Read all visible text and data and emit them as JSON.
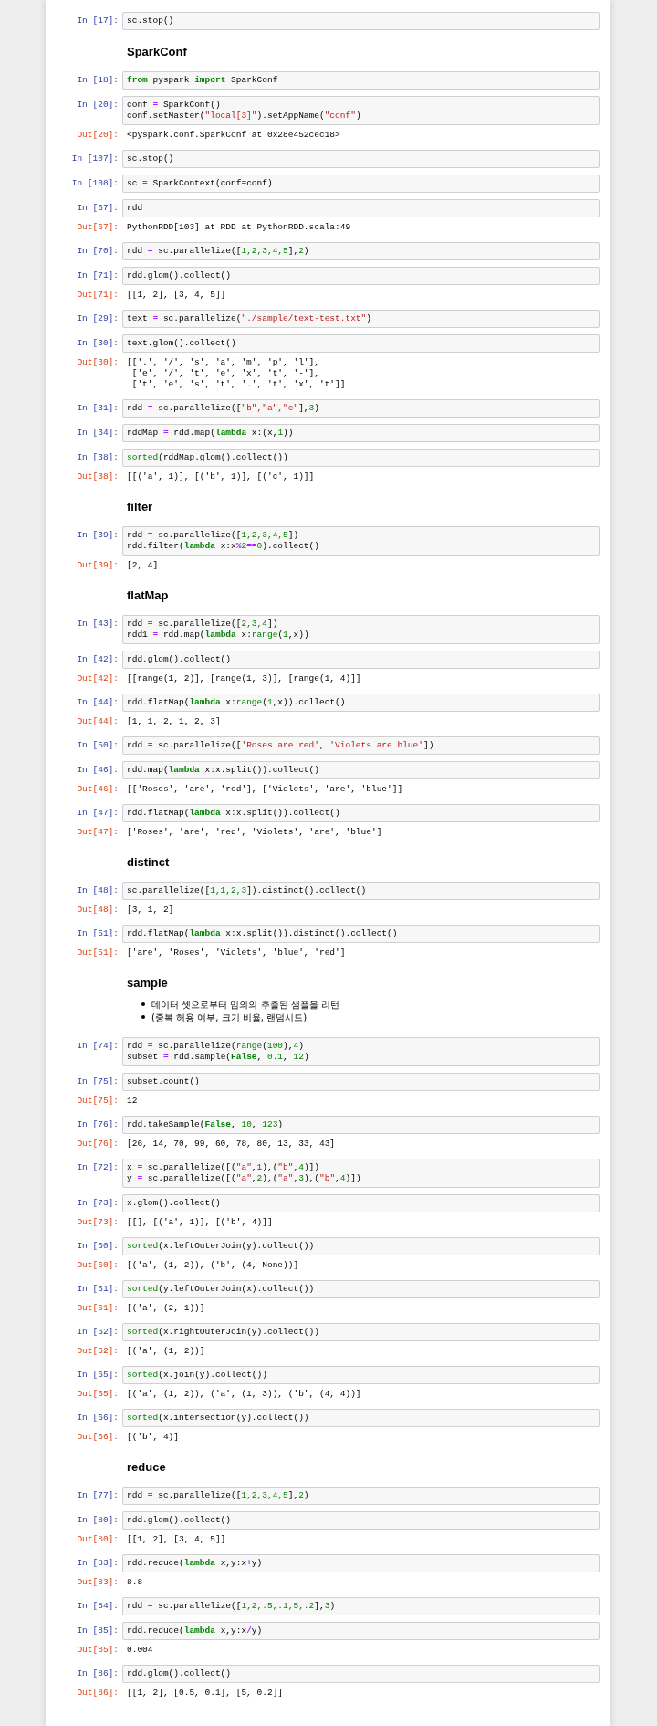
{
  "cells": [
    {
      "kind": "code",
      "prompt": "In [17]:",
      "source": [
        [
          {
            "text": "sc.stop()",
            "kind": "plain"
          }
        ]
      ]
    },
    {
      "kind": "heading",
      "text": "SparkConf"
    },
    {
      "kind": "code",
      "prompt": "In [18]:",
      "source": [
        [
          {
            "text": "from",
            "kind": "keyword"
          },
          {
            "text": " pyspark ",
            "kind": "plain"
          },
          {
            "text": "import",
            "kind": "keyword"
          },
          {
            "text": " SparkConf",
            "kind": "plain"
          }
        ]
      ]
    },
    {
      "kind": "code",
      "prompt": "In [20]:",
      "source": [
        [
          {
            "text": "conf ",
            "kind": "plain"
          },
          {
            "text": "=",
            "kind": "operator"
          },
          {
            "text": " SparkConf()",
            "kind": "plain"
          }
        ],
        [
          {
            "text": "conf.setMaster(",
            "kind": "plain"
          },
          {
            "text": "\"local[3]\"",
            "kind": "string"
          },
          {
            "text": ").setAppName(",
            "kind": "plain"
          },
          {
            "text": "\"conf\"",
            "kind": "string"
          },
          {
            "text": ")",
            "kind": "plain"
          }
        ]
      ],
      "output": {
        "prompt": "Out[20]:",
        "lines": [
          "<pyspark.conf.SparkConf at 0x28e452cec18>"
        ]
      }
    },
    {
      "kind": "code",
      "prompt": "In [107]:",
      "source": [
        [
          {
            "text": "sc.stop()",
            "kind": "plain"
          }
        ]
      ]
    },
    {
      "kind": "code",
      "prompt": "In [108]:",
      "source": [
        [
          {
            "text": "sc ",
            "kind": "plain"
          },
          {
            "text": "=",
            "kind": "operator"
          },
          {
            "text": " SparkContext(conf",
            "kind": "plain"
          },
          {
            "text": "=",
            "kind": "operator"
          },
          {
            "text": "conf)",
            "kind": "plain"
          }
        ]
      ]
    },
    {
      "kind": "code",
      "prompt": "In [67]:",
      "source": [
        [
          {
            "text": "rdd",
            "kind": "plain"
          }
        ]
      ],
      "output": {
        "prompt": "Out[67]:",
        "lines": [
          "PythonRDD[103] at RDD at PythonRDD.scala:49"
        ]
      }
    },
    {
      "kind": "code",
      "prompt": "In [70]:",
      "source": [
        [
          {
            "text": "rdd ",
            "kind": "plain"
          },
          {
            "text": "=",
            "kind": "operator"
          },
          {
            "text": " sc.parallelize([",
            "kind": "plain"
          },
          {
            "text": "1,2,3,4,5",
            "kind": "number"
          },
          {
            "text": "],",
            "kind": "plain"
          },
          {
            "text": "2",
            "kind": "number"
          },
          {
            "text": ")",
            "kind": "plain"
          }
        ]
      ]
    },
    {
      "kind": "code",
      "prompt": "In [71]:",
      "source": [
        [
          {
            "text": "rdd.glom().collect()",
            "kind": "plain"
          }
        ]
      ],
      "output": {
        "prompt": "Out[71]:",
        "lines": [
          "[[1, 2], [3, 4, 5]]"
        ]
      }
    },
    {
      "kind": "code",
      "prompt": "In [29]:",
      "source": [
        [
          {
            "text": "text ",
            "kind": "plain"
          },
          {
            "text": "=",
            "kind": "operator"
          },
          {
            "text": " sc.parallelize(",
            "kind": "plain"
          },
          {
            "text": "\"./sample/text-test.txt\"",
            "kind": "string"
          },
          {
            "text": ")",
            "kind": "plain"
          }
        ]
      ]
    },
    {
      "kind": "code",
      "prompt": "In [30]:",
      "source": [
        [
          {
            "text": "text.glom().collect()",
            "kind": "plain"
          }
        ]
      ],
      "output": {
        "prompt": "Out[30]:",
        "lines": [
          "[['.', '/', 's', 'a', 'm', 'p', 'l'],",
          " ['e', '/', 't', 'e', 'x', 't', '-'],",
          " ['t', 'e', 's', 't', '.', 't', 'x', 't']]"
        ]
      }
    },
    {
      "kind": "code",
      "prompt": "In [31]:",
      "source": [
        [
          {
            "text": "rdd ",
            "kind": "plain"
          },
          {
            "text": "=",
            "kind": "operator"
          },
          {
            "text": " sc.parallelize([",
            "kind": "plain"
          },
          {
            "text": "\"b\",\"a\",\"c\"",
            "kind": "string"
          },
          {
            "text": "],",
            "kind": "plain"
          },
          {
            "text": "3",
            "kind": "number"
          },
          {
            "text": ")",
            "kind": "plain"
          }
        ]
      ]
    },
    {
      "kind": "code",
      "prompt": "In [34]:",
      "source": [
        [
          {
            "text": "rddMap ",
            "kind": "plain"
          },
          {
            "text": "=",
            "kind": "operator"
          },
          {
            "text": " rdd.map(",
            "kind": "plain"
          },
          {
            "text": "lambda",
            "kind": "keyword"
          },
          {
            "text": " x:(x,",
            "kind": "plain"
          },
          {
            "text": "1",
            "kind": "number"
          },
          {
            "text": "))",
            "kind": "plain"
          }
        ]
      ]
    },
    {
      "kind": "code",
      "prompt": "In [38]:",
      "source": [
        [
          {
            "text": "sorted",
            "kind": "builtin"
          },
          {
            "text": "(rddMap.glom().collect())",
            "kind": "plain"
          }
        ]
      ],
      "output": {
        "prompt": "Out[38]:",
        "lines": [
          "[[('a', 1)], [('b', 1)], [('c', 1)]]"
        ]
      }
    },
    {
      "kind": "heading",
      "text": "filter"
    },
    {
      "kind": "code",
      "prompt": "In [39]:",
      "source": [
        [
          {
            "text": "rdd ",
            "kind": "plain"
          },
          {
            "text": "=",
            "kind": "operator"
          },
          {
            "text": " sc.parallelize([",
            "kind": "plain"
          },
          {
            "text": "1,2,3,4,5",
            "kind": "number"
          },
          {
            "text": "])",
            "kind": "plain"
          }
        ],
        [
          {
            "text": "rdd.filter(",
            "kind": "plain"
          },
          {
            "text": "lambda",
            "kind": "keyword"
          },
          {
            "text": " x:x",
            "kind": "plain"
          },
          {
            "text": "%",
            "kind": "operator"
          },
          {
            "text": "2",
            "kind": "number"
          },
          {
            "text": "==",
            "kind": "operator"
          },
          {
            "text": "0",
            "kind": "number"
          },
          {
            "text": ").collect()",
            "kind": "plain"
          }
        ]
      ],
      "output": {
        "prompt": "Out[39]:",
        "lines": [
          "[2, 4]"
        ]
      }
    },
    {
      "kind": "heading",
      "text": "flatMap"
    },
    {
      "kind": "code",
      "prompt": "In [43]:",
      "source": [
        [
          {
            "text": "rdd ",
            "kind": "plain"
          },
          {
            "text": "=",
            "kind": "operator"
          },
          {
            "text": " sc.parallelize([",
            "kind": "plain"
          },
          {
            "text": "2,3,4",
            "kind": "number"
          },
          {
            "text": "])",
            "kind": "plain"
          }
        ],
        [
          {
            "text": "rdd1 ",
            "kind": "plain"
          },
          {
            "text": "=",
            "kind": "operator"
          },
          {
            "text": " rdd.map(",
            "kind": "plain"
          },
          {
            "text": "lambda",
            "kind": "keyword"
          },
          {
            "text": " x:",
            "kind": "plain"
          },
          {
            "text": "range",
            "kind": "builtin"
          },
          {
            "text": "(",
            "kind": "plain"
          },
          {
            "text": "1",
            "kind": "number"
          },
          {
            "text": ",x))",
            "kind": "plain"
          }
        ]
      ]
    },
    {
      "kind": "code",
      "prompt": "In [42]:",
      "source": [
        [
          {
            "text": "rdd.glom().collect()",
            "kind": "plain"
          }
        ]
      ],
      "output": {
        "prompt": "Out[42]:",
        "lines": [
          "[[range(1, 2)], [range(1, 3)], [range(1, 4)]]"
        ]
      }
    },
    {
      "kind": "code",
      "prompt": "In [44]:",
      "source": [
        [
          {
            "text": "rdd.flatMap(",
            "kind": "plain"
          },
          {
            "text": "lambda",
            "kind": "keyword"
          },
          {
            "text": " x:",
            "kind": "plain"
          },
          {
            "text": "range",
            "kind": "builtin"
          },
          {
            "text": "(",
            "kind": "plain"
          },
          {
            "text": "1",
            "kind": "number"
          },
          {
            "text": ",x)).collect()",
            "kind": "plain"
          }
        ]
      ],
      "output": {
        "prompt": "Out[44]:",
        "lines": [
          "[1, 1, 2, 1, 2, 3]"
        ]
      }
    },
    {
      "kind": "code",
      "prompt": "In [50]:",
      "source": [
        [
          {
            "text": "rdd ",
            "kind": "plain"
          },
          {
            "text": "=",
            "kind": "operator"
          },
          {
            "text": " sc.parallelize([",
            "kind": "plain"
          },
          {
            "text": "'Roses are red'",
            "kind": "string"
          },
          {
            "text": ", ",
            "kind": "plain"
          },
          {
            "text": "'Violets are blue'",
            "kind": "string"
          },
          {
            "text": "])",
            "kind": "plain"
          }
        ]
      ]
    },
    {
      "kind": "code",
      "prompt": "In [46]:",
      "source": [
        [
          {
            "text": "rdd.map(",
            "kind": "plain"
          },
          {
            "text": "lambda",
            "kind": "keyword"
          },
          {
            "text": " x:x.split()).collect()",
            "kind": "plain"
          }
        ]
      ],
      "output": {
        "prompt": "Out[46]:",
        "lines": [
          "[['Roses', 'are', 'red'], ['Violets', 'are', 'blue']]"
        ]
      }
    },
    {
      "kind": "code",
      "prompt": "In [47]:",
      "source": [
        [
          {
            "text": "rdd.flatMap(",
            "kind": "plain"
          },
          {
            "text": "lambda",
            "kind": "keyword"
          },
          {
            "text": " x:x.split()).collect()",
            "kind": "plain"
          }
        ]
      ],
      "output": {
        "prompt": "Out[47]:",
        "lines": [
          "['Roses', 'are', 'red', 'Violets', 'are', 'blue']"
        ]
      }
    },
    {
      "kind": "heading",
      "text": "distinct"
    },
    {
      "kind": "code",
      "prompt": "In [48]:",
      "source": [
        [
          {
            "text": "sc.parallelize([",
            "kind": "plain"
          },
          {
            "text": "1,1,2,3",
            "kind": "number"
          },
          {
            "text": "]).distinct().collect()",
            "kind": "plain"
          }
        ]
      ],
      "output": {
        "prompt": "Out[48]:",
        "lines": [
          "[3, 1, 2]"
        ]
      }
    },
    {
      "kind": "code",
      "prompt": "In [51]:",
      "source": [
        [
          {
            "text": "rdd.flatMap(",
            "kind": "plain"
          },
          {
            "text": "lambda",
            "kind": "keyword"
          },
          {
            "text": " x:x.split()).distinct().collect()",
            "kind": "plain"
          }
        ]
      ],
      "output": {
        "prompt": "Out[51]:",
        "lines": [
          "['are', 'Roses', 'Violets', 'blue', 'red']"
        ]
      }
    },
    {
      "kind": "heading",
      "text": "sample",
      "bullets": [
        "데이터 셋으로부터 임의의 추출된 샘플을 리턴",
        "(중복 허용 여부, 크기 비율, 랜덤시드)"
      ]
    },
    {
      "kind": "code",
      "prompt": "In [74]:",
      "source": [
        [
          {
            "text": "rdd ",
            "kind": "plain"
          },
          {
            "text": "=",
            "kind": "operator"
          },
          {
            "text": " sc.parallelize(",
            "kind": "plain"
          },
          {
            "text": "range",
            "kind": "builtin"
          },
          {
            "text": "(",
            "kind": "plain"
          },
          {
            "text": "100",
            "kind": "number"
          },
          {
            "text": "),",
            "kind": "plain"
          },
          {
            "text": "4",
            "kind": "number"
          },
          {
            "text": ")",
            "kind": "plain"
          }
        ],
        [
          {
            "text": "subset ",
            "kind": "plain"
          },
          {
            "text": "=",
            "kind": "operator"
          },
          {
            "text": " rdd.sample(",
            "kind": "plain"
          },
          {
            "text": "False",
            "kind": "keyword"
          },
          {
            "text": ", ",
            "kind": "plain"
          },
          {
            "text": "0.1",
            "kind": "number"
          },
          {
            "text": ", ",
            "kind": "plain"
          },
          {
            "text": "12",
            "kind": "number"
          },
          {
            "text": ")",
            "kind": "plain"
          }
        ]
      ]
    },
    {
      "kind": "code",
      "prompt": "In [75]:",
      "source": [
        [
          {
            "text": "subset.count()",
            "kind": "plain"
          }
        ]
      ],
      "output": {
        "prompt": "Out[75]:",
        "lines": [
          "12"
        ]
      }
    },
    {
      "kind": "code",
      "prompt": "In [76]:",
      "source": [
        [
          {
            "text": "rdd.takeSample(",
            "kind": "plain"
          },
          {
            "text": "False",
            "kind": "keyword"
          },
          {
            "text": ", ",
            "kind": "plain"
          },
          {
            "text": "10",
            "kind": "number"
          },
          {
            "text": ", ",
            "kind": "plain"
          },
          {
            "text": "123",
            "kind": "number"
          },
          {
            "text": ")",
            "kind": "plain"
          }
        ]
      ],
      "output": {
        "prompt": "Out[76]:",
        "lines": [
          "[26, 14, 70, 99, 60, 78, 80, 13, 33, 43]"
        ]
      }
    },
    {
      "kind": "code",
      "prompt": "In [72]:",
      "source": [
        [
          {
            "text": "x ",
            "kind": "plain"
          },
          {
            "text": "=",
            "kind": "operator"
          },
          {
            "text": " sc.parallelize([(",
            "kind": "plain"
          },
          {
            "text": "\"a\"",
            "kind": "string"
          },
          {
            "text": ",",
            "kind": "plain"
          },
          {
            "text": "1",
            "kind": "number"
          },
          {
            "text": "),(",
            "kind": "plain"
          },
          {
            "text": "\"b\"",
            "kind": "string"
          },
          {
            "text": ",",
            "kind": "plain"
          },
          {
            "text": "4",
            "kind": "number"
          },
          {
            "text": ")])",
            "kind": "plain"
          }
        ],
        [
          {
            "text": "y ",
            "kind": "plain"
          },
          {
            "text": "=",
            "kind": "operator"
          },
          {
            "text": " sc.parallelize([(",
            "kind": "plain"
          },
          {
            "text": "\"a\"",
            "kind": "string"
          },
          {
            "text": ",",
            "kind": "plain"
          },
          {
            "text": "2",
            "kind": "number"
          },
          {
            "text": "),(",
            "kind": "plain"
          },
          {
            "text": "\"a\"",
            "kind": "string"
          },
          {
            "text": ",",
            "kind": "plain"
          },
          {
            "text": "3",
            "kind": "number"
          },
          {
            "text": "),(",
            "kind": "plain"
          },
          {
            "text": "\"b\"",
            "kind": "string"
          },
          {
            "text": ",",
            "kind": "plain"
          },
          {
            "text": "4",
            "kind": "number"
          },
          {
            "text": ")])",
            "kind": "plain"
          }
        ]
      ]
    },
    {
      "kind": "code",
      "prompt": "In [73]:",
      "source": [
        [
          {
            "text": "x.glom().collect()",
            "kind": "plain"
          }
        ]
      ],
      "output": {
        "prompt": "Out[73]:",
        "lines": [
          "[[], [('a', 1)], [('b', 4)]]"
        ]
      }
    },
    {
      "kind": "code",
      "prompt": "In [60]:",
      "source": [
        [
          {
            "text": "sorted",
            "kind": "builtin"
          },
          {
            "text": "(x.leftOuterJoin(y).collect())",
            "kind": "plain"
          }
        ]
      ],
      "output": {
        "prompt": "Out[60]:",
        "lines": [
          "[('a', (1, 2)), ('b', (4, None))]"
        ]
      }
    },
    {
      "kind": "code",
      "prompt": "In [61]:",
      "source": [
        [
          {
            "text": "sorted",
            "kind": "builtin"
          },
          {
            "text": "(y.leftOuterJoin(x).collect())",
            "kind": "plain"
          }
        ]
      ],
      "output": {
        "prompt": "Out[61]:",
        "lines": [
          "[('a', (2, 1))]"
        ]
      }
    },
    {
      "kind": "code",
      "prompt": "In [62]:",
      "source": [
        [
          {
            "text": "sorted",
            "kind": "builtin"
          },
          {
            "text": "(x.rightOuterJoin(y).collect())",
            "kind": "plain"
          }
        ]
      ],
      "output": {
        "prompt": "Out[62]:",
        "lines": [
          "[('a', (1, 2))]"
        ]
      }
    },
    {
      "kind": "code",
      "prompt": "In [65]:",
      "source": [
        [
          {
            "text": "sorted",
            "kind": "builtin"
          },
          {
            "text": "(x.join(y).collect())",
            "kind": "plain"
          }
        ]
      ],
      "output": {
        "prompt": "Out[65]:",
        "lines": [
          "[('a', (1, 2)), ('a', (1, 3)), ('b', (4, 4))]"
        ]
      }
    },
    {
      "kind": "code",
      "prompt": "In [66]:",
      "source": [
        [
          {
            "text": "sorted",
            "kind": "builtin"
          },
          {
            "text": "(x.intersection(y).collect())",
            "kind": "plain"
          }
        ]
      ],
      "output": {
        "prompt": "Out[66]:",
        "lines": [
          "[('b', 4)]"
        ]
      }
    },
    {
      "kind": "heading",
      "text": "reduce"
    },
    {
      "kind": "code",
      "prompt": "In [77]:",
      "source": [
        [
          {
            "text": "rdd ",
            "kind": "plain"
          },
          {
            "text": "=",
            "kind": "operator"
          },
          {
            "text": " sc.parallelize([",
            "kind": "plain"
          },
          {
            "text": "1,2,3,4,5",
            "kind": "number"
          },
          {
            "text": "],",
            "kind": "plain"
          },
          {
            "text": "2",
            "kind": "number"
          },
          {
            "text": ")",
            "kind": "plain"
          }
        ]
      ]
    },
    {
      "kind": "code",
      "prompt": "In [80]:",
      "source": [
        [
          {
            "text": "rdd.glom().collect()",
            "kind": "plain"
          }
        ]
      ],
      "output": {
        "prompt": "Out[80]:",
        "lines": [
          "[[1, 2], [3, 4, 5]]"
        ]
      }
    },
    {
      "kind": "code",
      "prompt": "In [83]:",
      "source": [
        [
          {
            "text": "rdd.reduce(",
            "kind": "plain"
          },
          {
            "text": "lambda",
            "kind": "keyword"
          },
          {
            "text": " x,y:x",
            "kind": "plain"
          },
          {
            "text": "+",
            "kind": "operator"
          },
          {
            "text": "y)",
            "kind": "plain"
          }
        ]
      ],
      "output": {
        "prompt": "Out[83]:",
        "lines": [
          "8.8"
        ]
      }
    },
    {
      "kind": "code",
      "prompt": "In [84]:",
      "source": [
        [
          {
            "text": "rdd ",
            "kind": "plain"
          },
          {
            "text": "=",
            "kind": "operator"
          },
          {
            "text": " sc.parallelize([",
            "kind": "plain"
          },
          {
            "text": "1,2,.5,.1,5,.2",
            "kind": "number"
          },
          {
            "text": "],",
            "kind": "plain"
          },
          {
            "text": "3",
            "kind": "number"
          },
          {
            "text": ")",
            "kind": "plain"
          }
        ]
      ]
    },
    {
      "kind": "code",
      "prompt": "In [85]:",
      "source": [
        [
          {
            "text": "rdd.reduce(",
            "kind": "plain"
          },
          {
            "text": "lambda",
            "kind": "keyword"
          },
          {
            "text": " x,y:x",
            "kind": "plain"
          },
          {
            "text": "/",
            "kind": "operator"
          },
          {
            "text": "y)",
            "kind": "plain"
          }
        ]
      ],
      "output": {
        "prompt": "Out[85]:",
        "lines": [
          "0.004"
        ]
      }
    },
    {
      "kind": "code",
      "prompt": "In [86]:",
      "source": [
        [
          {
            "text": "rdd.glom().collect()",
            "kind": "plain"
          }
        ]
      ],
      "output": {
        "prompt": "Out[86]:",
        "lines": [
          "[[1, 2], [0.5, 0.1], [5, 0.2]]"
        ]
      }
    }
  ]
}
